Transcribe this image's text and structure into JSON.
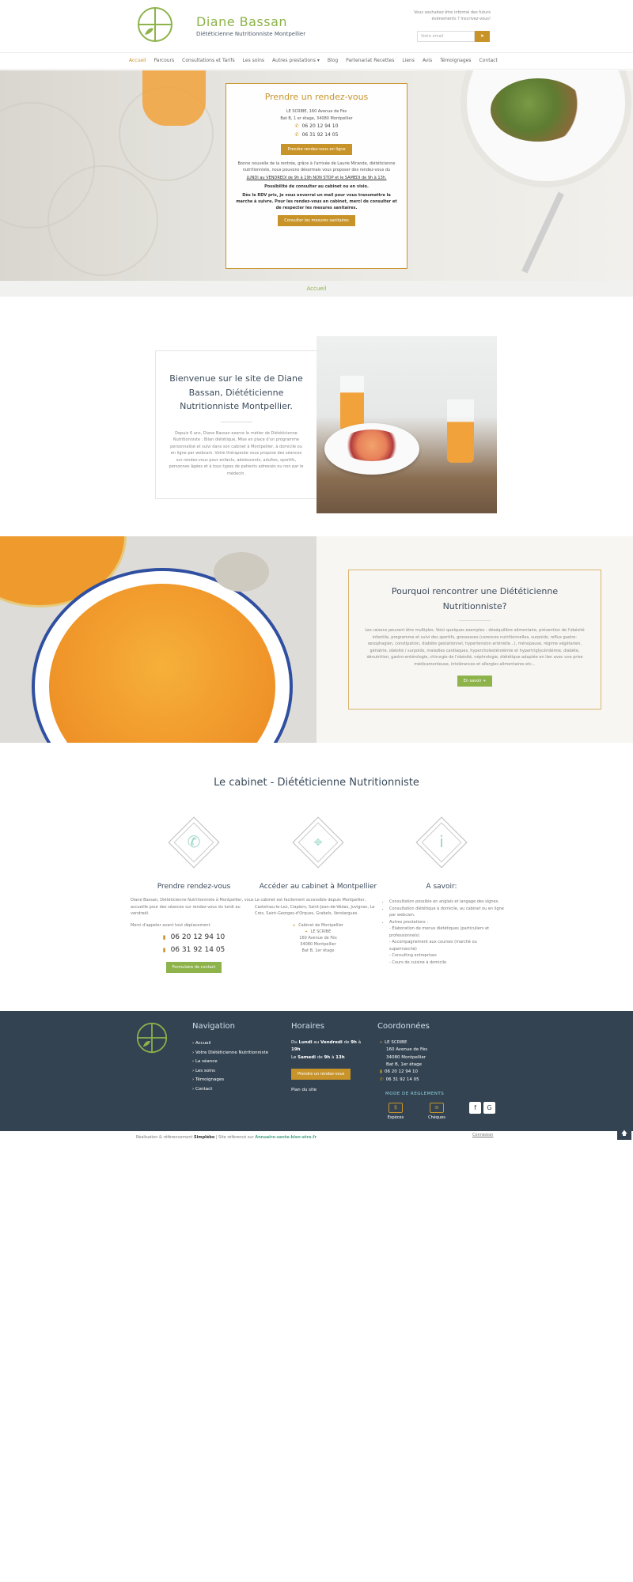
{
  "header": {
    "brand_name": "Diane Bassan",
    "brand_sub": "Diététicienne Nutritionniste Montpellier",
    "newsletter_text": "Vous souhaitez être informé des futurs évènements ? Inscrivez-vous!",
    "newsletter_placeholder": "Votre email",
    "newsletter_btn": "➤"
  },
  "nav": {
    "items": [
      "Accueil",
      "Parcours",
      "Consultations et Tarifs",
      "Les soins",
      "Autres prestations ▾",
      "Blog",
      "Partenariat Recettes",
      "Liens",
      "Avis",
      "Témoignages",
      "Contact"
    ]
  },
  "hero": {
    "title": "Prendre un rendez-vous",
    "addr1": "LE SCRIBE, 160 Avenue de Fès",
    "addr2": "Bat B, 1 er étage, 34080 Montpellier",
    "phone1": "06 20 12 94 10",
    "phone2": "06 31 92 14 05",
    "btn_online": "Prendre rendez-vous en ligne",
    "text_intro": "Bonne nouvelle de la rentrée, grâce à l'arrivée de Laurie Mirande, diététicienne nutritionniste, nous pouvons désormais vous proposer des rendez-vous du",
    "text_hours": "LUNDI au VENDREDI de 9h à 19h NON STOP et le SAMEDI de 9h à 13h.",
    "text_visio": "Possibilité de consulter au cabinet ou en visio.",
    "text_covid": "Dès le RDV pris, je vous enverrai un mail pour vous transmettre la marche à suivre. Pour les rendez-vous en cabinet, merci de consulter et de respecter les mesures sanitaires.",
    "btn_measures": "Consulter les mesures sanitaires"
  },
  "breadcrumb": {
    "label": "Accueil"
  },
  "welcome": {
    "title": "Bienvenue sur le site de Diane Bassan, Diététicienne Nutritionniste Montpellier.",
    "text": "Depuis 6 ans, Diane Bassan exerce le métier de Diététicienne Nutritionniste : Bilan diététique, Mise en place d'un programme personnalisé et suivi dans son cabinet à Montpellier, à domicile ou en ligne par webcam. Votre thérapeute vous propose des séances sur rendez-vous pour enfants, adolescents, adultes, sportifs, personnes âgées et à tous types de patients adressés ou non par le médecin."
  },
  "why": {
    "title": "Pourquoi rencontrer une Diététicienne Nutritionniste?",
    "text": "Les raisons peuvent être multiples. Voici quelques exemples : déséquilibre alimentaire, prévention de l'obésité infantile, programme et suivi des sportifs, grossesses (carences nutritionnelles, surpoids, reflux gastro-œsophagien, constipation, diabète gestationnel, hypertension artérielle...), ménopause, régime végétarien, gériatrie, obésité / surpoids, maladies cardiaques, hypercholestérolémie et hypertriglycéridémie, diabète, dénutrition, gastro-entérologie, chirurgie de l'obésité, néphrologie, diététique adaptée en lien avec une prise médicamenteuse, intolérances et allergies alimentaires etc...",
    "btn": "En savoir +"
  },
  "cabinet": {
    "title": "Le cabinet - Diététicienne Nutritionniste",
    "col1": {
      "title": "Prendre rendez-vous",
      "text1": "Diane Bassan, Diététicienne Nutritionniste à Montpellier, vous accueille pour des séances sur rendez-vous du lundi au vendredi.",
      "text2": "Merci d'appeler avant tout déplacement",
      "phone1": "06 20 12 94 10",
      "phone2": "06 31 92 14 05",
      "btn": "Formulaire de contact"
    },
    "col2": {
      "title": "Accéder au cabinet à Montpellier",
      "text": "Le cabinet est facilement accessible depuis Montpellier, Castelnau-le-Lez, Clapiers, Saint-Jean-de-Védas, Juvignac, Le Crès, Saint-Georges-d'Orques, Grabels, Vendargues.",
      "addr_title": "Cabinet de Montpellier",
      "addr1": "LE SCRIBE",
      "addr2": "160 Avenue de Fès",
      "addr3": "34080 Montpellier",
      "addr4": "Bat B, 1er étage"
    },
    "col3": {
      "title": "A savoir:",
      "b1": "Consultation possible en anglais et langage des signes.",
      "b2": "Consultation diététique à domicile, au cabinet ou en ligne par webcam.",
      "b3": "Autres prestations :",
      "b3a": "- Élaboration de menus diététiques (particuliers et professionnels)",
      "b3b": "- Accompagnement aux courses (marché ou supermarché)",
      "b3c": "- Consulting entreprises",
      "b3d": "- Cours de cuisine à domicile"
    }
  },
  "footer": {
    "nav_title": "Navigation",
    "nav_items": [
      "› Accueil",
      "› Votre Diététicienne Nutritionniste",
      "› La séance",
      "› Les soins",
      "› Témoignages",
      "› Contact"
    ],
    "hours_title": "Horaires",
    "hours1_a": "Du ",
    "hours1_b": "Lundi",
    "hours1_c": " au ",
    "hours1_d": "Vendredi",
    "hours1_e": " de ",
    "hours1_f": "9h",
    "hours1_g": " à ",
    "hours1_h": "19h",
    "hours2_a": "Le ",
    "hours2_b": "Samedi",
    "hours2_c": " de ",
    "hours2_d": "9h",
    "hours2_e": " à ",
    "hours2_f": "13h",
    "btn": "Prendre un rendez-vous",
    "plan": "Plan du site",
    "coord_title": "Coordonnées",
    "coord1": "LE SCRIBE",
    "coord2": "160 Avenue de Fès",
    "coord3": "34080 Montpellier",
    "coord4": "Bat B, 1er étage",
    "phone1": "06 20 12 94 10",
    "phone2": "06 31 92 14 05",
    "payment_title": "MODE DE REGLEMENTS",
    "pay1": "Espèces",
    "pay2": "Chèques",
    "social_fb": "f",
    "social_g": "G"
  },
  "bottom": {
    "prefix": "Réalisation & référencement",
    "brand": "Simplébo",
    "sep": "|",
    "listed": "Site référencé sur",
    "directory": "Annuaire-sante-bien-etre.fr",
    "login": "Connexion",
    "scroll_top": "🡅"
  }
}
